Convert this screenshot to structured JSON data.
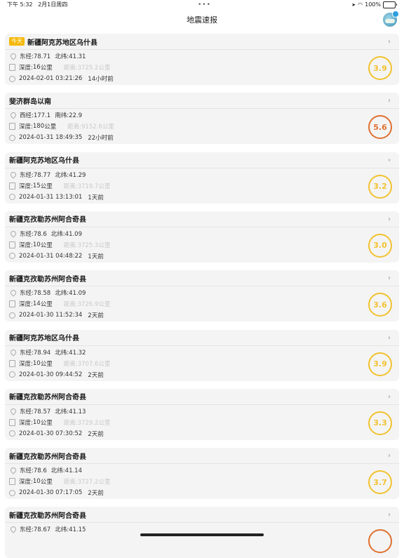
{
  "statusbar": {
    "time": "下午 5:32",
    "date": "2月1日周四",
    "dots": "•••",
    "battery_text": "100%",
    "battery_level": 1.0
  },
  "navbar": {
    "title": "地震速报"
  },
  "labels": {
    "today_badge": "今天",
    "depth_prefix": "深度:",
    "depth_unit": "公里"
  },
  "quakes": [
    {
      "today": true,
      "place": "新疆阿克苏地区乌什县",
      "lon": "东经:78.71",
      "lat": "北纬:41.31",
      "depth": "16",
      "distance": "距离:3725.2公里",
      "time": "2024-02-01 03:21:26",
      "ago": "14小时前",
      "magnitude": "3.9",
      "color": "#f2c230"
    },
    {
      "today": false,
      "place": "斐济群岛以南",
      "lon": "西经:177.1",
      "lat": "南纬:22.9",
      "depth": "180",
      "distance": "距离:9152.6公里",
      "time": "2024-01-31 18:49:35",
      "ago": "22小时前",
      "magnitude": "5.6",
      "color": "#e07030"
    },
    {
      "today": false,
      "place": "新疆阿克苏地区乌什县",
      "lon": "东经:78.77",
      "lat": "北纬:41.29",
      "depth": "15",
      "distance": "距离:3719.7公里",
      "time": "2024-01-31 13:13:01",
      "ago": "1天前",
      "magnitude": "3.2",
      "color": "#f2c230"
    },
    {
      "today": false,
      "place": "新疆克孜勒苏州阿合奇县",
      "lon": "东经:78.6",
      "lat": "北纬:41.09",
      "depth": "10",
      "distance": "距离:3725.3公里",
      "time": "2024-01-31 04:48:22",
      "ago": "1天前",
      "magnitude": "3.0",
      "color": "#f2c230"
    },
    {
      "today": false,
      "place": "新疆克孜勒苏州阿合奇县",
      "lon": "东经:78.58",
      "lat": "北纬:41.09",
      "depth": "14",
      "distance": "距离:3726.9公里",
      "time": "2024-01-30 11:52:34",
      "ago": "2天前",
      "magnitude": "3.6",
      "color": "#f2c230"
    },
    {
      "today": false,
      "place": "新疆阿克苏地区乌什县",
      "lon": "东经:78.94",
      "lat": "北纬:41.32",
      "depth": "10",
      "distance": "距离:3707.6公里",
      "time": "2024-01-30 09:44:52",
      "ago": "2天前",
      "magnitude": "3.9",
      "color": "#f2c230"
    },
    {
      "today": false,
      "place": "新疆克孜勒苏州阿合奇县",
      "lon": "东经:78.57",
      "lat": "北纬:41.13",
      "depth": "10",
      "distance": "距离:3729.2公里",
      "time": "2024-01-30 07:30:52",
      "ago": "2天前",
      "magnitude": "3.3",
      "color": "#f2c230"
    },
    {
      "today": false,
      "place": "新疆克孜勒苏州阿合奇县",
      "lon": "东经:78.6",
      "lat": "北纬:41.14",
      "depth": "10",
      "distance": "距离:3727.2公里",
      "time": "2024-01-30 07:17:05",
      "ago": "2天前",
      "magnitude": "3.7",
      "color": "#f2c230"
    },
    {
      "today": false,
      "place": "新疆克孜勒苏州阿合奇县",
      "lon": "东经:78.67",
      "lat": "北纬:41.15",
      "depth": "",
      "distance": "",
      "time": "",
      "ago": "",
      "magnitude": "",
      "color": "#e07030"
    }
  ]
}
